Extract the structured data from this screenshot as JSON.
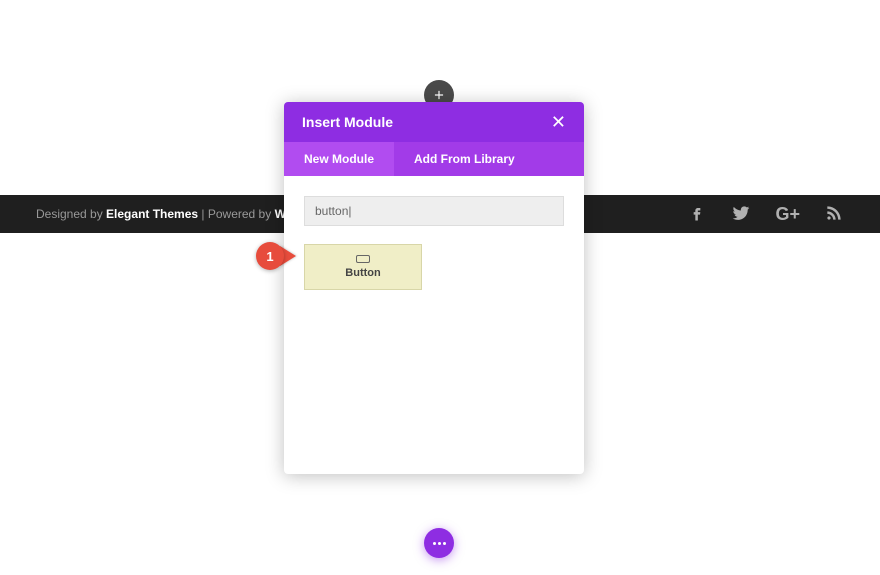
{
  "footer": {
    "prefix": "Designed by ",
    "brand": "Elegant Themes",
    "separator": " | Powered by ",
    "platform": "WordPress"
  },
  "modal": {
    "title": "Insert Module",
    "tabs": {
      "new": "New Module",
      "library": "Add From Library"
    },
    "search_value": "button|",
    "module_label": "Button"
  },
  "annotation": {
    "step": "1"
  },
  "social": {
    "gplus": "G+"
  }
}
